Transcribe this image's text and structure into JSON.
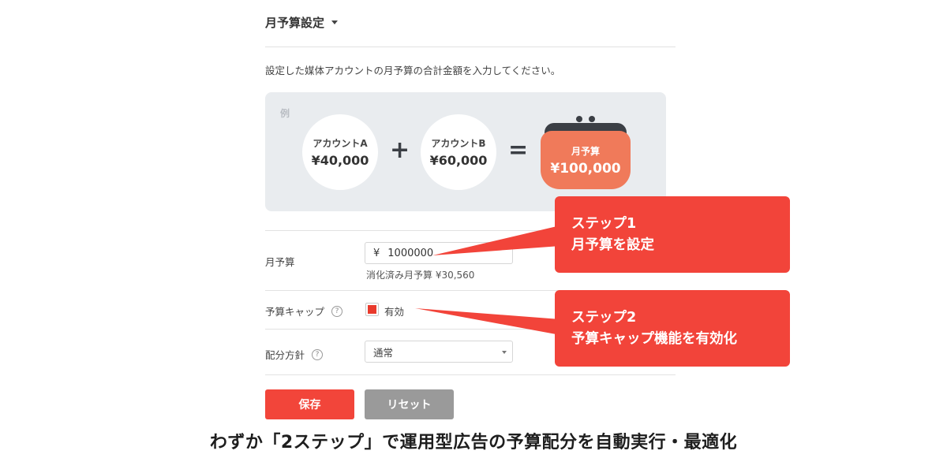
{
  "section": {
    "title": "月予算設定",
    "description": "設定した媒体アカウントの月予算の合計金額を入力してください。"
  },
  "example": {
    "label": "例",
    "account_a": {
      "name": "アカウントA",
      "amount": "¥40,000"
    },
    "plus": "+",
    "account_b": {
      "name": "アカウントB",
      "amount": "¥60,000"
    },
    "equals": "=",
    "total": {
      "name": "月予算",
      "amount": "¥100,000"
    }
  },
  "form": {
    "monthly_budget": {
      "label": "月予算",
      "currency": "¥",
      "value": "1000000",
      "consumed_note": "消化済み月予算 ¥30,560"
    },
    "budget_cap": {
      "label": "予算キャップ",
      "help": "?",
      "checkbox_label": "有効",
      "checked": true
    },
    "allocation": {
      "label": "配分方針",
      "help": "?",
      "selected": "通常"
    }
  },
  "buttons": {
    "save": "保存",
    "reset": "リセット"
  },
  "callouts": {
    "step1_line1": "ステップ1",
    "step1_line2": "月予算を設定",
    "step2_line1": "ステップ2",
    "step2_line2": "予算キャップ機能を有効化"
  },
  "caption": "わずか「2ステップ」で運用型広告の予算配分を自動実行・最適化",
  "colors": {
    "accent": "#f2443a",
    "purse": "#f07a5a",
    "panel": "#e9ecef",
    "reset_button": "#9a9a9a"
  }
}
